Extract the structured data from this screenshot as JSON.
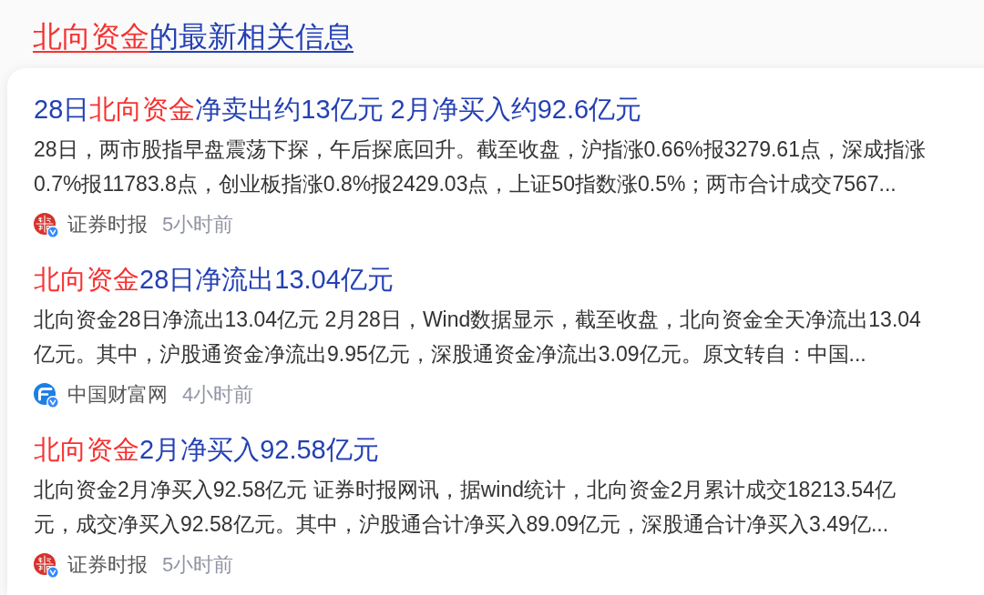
{
  "section_title": {
    "segments": [
      {
        "kind": "keyword",
        "text": "北向资金"
      },
      {
        "kind": "plain",
        "text": "的最新相关信息"
      }
    ]
  },
  "results": [
    {
      "title": [
        {
          "kind": "plain",
          "text": "28日"
        },
        {
          "kind": "keyword",
          "text": "北向资金"
        },
        {
          "kind": "plain",
          "text": "净卖出约13亿元 2月净买入约92.6亿元"
        }
      ],
      "snippet": [
        "28日，两市股指早盘震荡下探，午后探底回升。截至收盘，沪指涨0.66%报3279.61点，深成指涨",
        "0.7%报11783.8点，创业板指涨0.8%报2429.03点，上证50指数涨0.5%；两市合计成交7567..."
      ],
      "source": {
        "kind": "seal",
        "name": "证券时报",
        "verified": true,
        "time": "5小时前"
      }
    },
    {
      "title": [
        {
          "kind": "keyword",
          "text": "北向资金"
        },
        {
          "kind": "plain",
          "text": "28日净流出13.04亿元"
        }
      ],
      "snippet": [
        "北向资金28日净流出13.04亿元 2月28日，Wind数据显示，截至收盘，北向资金全天净流出13.04",
        "亿元。其中，沪股通资金净流出9.95亿元，深股通资金净流出3.09亿元。原文转自：中国..."
      ],
      "source": {
        "kind": "swoosh",
        "name": "中国财富网",
        "verified": true,
        "time": "4小时前"
      }
    },
    {
      "title": [
        {
          "kind": "keyword",
          "text": "北向资金"
        },
        {
          "kind": "plain",
          "text": "2月净买入92.58亿元"
        }
      ],
      "snippet": [
        "北向资金2月净买入92.58亿元 证券时报网讯，据wind统计，北向资金2月累计成交18213.54亿",
        "元，成交净买入92.58亿元。其中，沪股通合计净买入89.09亿元，深股通合计净买入3.49亿..."
      ],
      "source": {
        "kind": "seal",
        "name": "证券时报",
        "verified": true,
        "time": "5小时前"
      }
    }
  ]
}
